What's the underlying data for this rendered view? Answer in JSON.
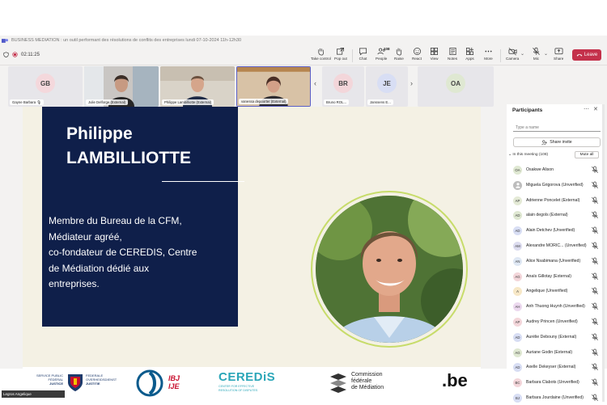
{
  "window": {
    "title": "BUSINESS MEDIATION : un outil performant des résolutions de conflits des entreprises lundi 07-10-2024 11h-12h30"
  },
  "toolbar": {
    "timer": "02:11:25",
    "buttons": [
      {
        "label": "Take control",
        "icon": "hand-icon"
      },
      {
        "label": "Pop out",
        "icon": "popout-icon"
      },
      {
        "label": "Chat",
        "icon": "chat-icon"
      },
      {
        "label": "People",
        "icon": "people-icon",
        "badge": "108"
      },
      {
        "label": "Raise",
        "icon": "hand-raise-icon"
      },
      {
        "label": "React",
        "icon": "react-icon"
      },
      {
        "label": "View",
        "icon": "view-icon"
      },
      {
        "label": "Notes",
        "icon": "notes-icon"
      },
      {
        "label": "Apps",
        "icon": "apps-icon"
      },
      {
        "label": "More",
        "icon": "more-icon"
      },
      {
        "label": "Camera",
        "icon": "camera-off-icon"
      },
      {
        "label": "Mic",
        "icon": "mic-off-icon"
      },
      {
        "label": "Share",
        "icon": "share-icon"
      }
    ],
    "leave_label": "Leave",
    "leave_color": "#c4314b"
  },
  "gallery": [
    {
      "name": "Gayne Barbara",
      "initials": "GB",
      "avatar_color": "#f4d8dc"
    },
    {
      "name": "Julie Delforge (External)",
      "initials": "",
      "avatar_color": ""
    },
    {
      "name": "Philippe Lambilliotte (External)",
      "initials": "",
      "avatar_color": ""
    },
    {
      "name": "vanessa depoorter (External)",
      "initials": "",
      "avatar_color": ""
    },
    {
      "name": "Bruno ROL...",
      "initials": "BR",
      "avatar_color": "#f3d6da"
    },
    {
      "name": "Janssens E...",
      "initials": "JE",
      "avatar_color": "#d8def4"
    },
    {
      "name": "",
      "initials": "OA",
      "avatar_color": "#dfe8d2"
    }
  ],
  "slide": {
    "name_first": "Philippe",
    "name_last": "LAMBILLIOTTE",
    "description": "Membre du Bureau de la CFM,\nMédiateur agréé,\nco-fondateur de CEREDIS, Centre\nde Médiation dédié aux\nentreprises.",
    "navy_color": "#0f1f4a",
    "ring_color": "#c7dc6a",
    "logos": {
      "justice": [
        "SERVICE PUBLIC FÉDÉRAL",
        "JUSTICE",
        "FEDERALE OVERHEIDSDIENST",
        "JUSTITIE"
      ],
      "ibj": "IBJ\nIJE",
      "ceredis_name": "CEREDiS",
      "ceredis_tagline": "CENTER FOR EFFECTIVE\nRESOLUTION OF DISPUTES",
      "commission": "Commission\nfédérale\nde Médiation",
      "be": ".be"
    }
  },
  "self_view": {
    "name": "Legros Angelique"
  },
  "participants": {
    "title": "Participants",
    "search_placeholder": "Type a name",
    "invite_label": "Share invite",
    "section_label": "In this meeting (108)",
    "mute_all_label": "Mute all",
    "people": [
      {
        "name": "Osakwe Alison",
        "initials": "OA",
        "color": "#dfe8d2"
      },
      {
        "name": "Miguela Grigorova (Unverified)",
        "initials": "",
        "color": "#bdbdbd"
      },
      {
        "name": "Adrienne Poncelet (External)",
        "initials": "AP",
        "color": "#e4ead6"
      },
      {
        "name": "alain degols (External)",
        "initials": "AD",
        "color": "#dfe8d2"
      },
      {
        "name": "Alain Detchev (Unverified)",
        "initials": "AD",
        "color": "#d8def4"
      },
      {
        "name": "Alexandre MORIC... (Unverified)",
        "initials": "AM",
        "color": "#dcdcef"
      },
      {
        "name": "Alice Nsabimana (Unverified)",
        "initials": "AN",
        "color": "#dfe8f4"
      },
      {
        "name": "Anaïs Gillotay (External)",
        "initials": "AG",
        "color": "#f3d6da"
      },
      {
        "name": "Angelique (Unverified)",
        "initials": "A",
        "color": "#f7e8c7"
      },
      {
        "name": "Anh Thuong Huynh (Unverified)",
        "initials": "AH",
        "color": "#ecd9ef"
      },
      {
        "name": "Audrey Princen (Unverified)",
        "initials": "AP",
        "color": "#f3d6da"
      },
      {
        "name": "Aurélie Debouny (External)",
        "initials": "AD",
        "color": "#d8def4"
      },
      {
        "name": "Auriane Godin (External)",
        "initials": "AG",
        "color": "#dfe8d2"
      },
      {
        "name": "Axelle Dekeyser (External)",
        "initials": "AD",
        "color": "#d8def4"
      },
      {
        "name": "Barbara Clabots (Unverified)",
        "initials": "BC",
        "color": "#f3d6da"
      },
      {
        "name": "Barbara Jourdaine (Unverified)",
        "initials": "BJ",
        "color": "#d8def4"
      }
    ]
  }
}
